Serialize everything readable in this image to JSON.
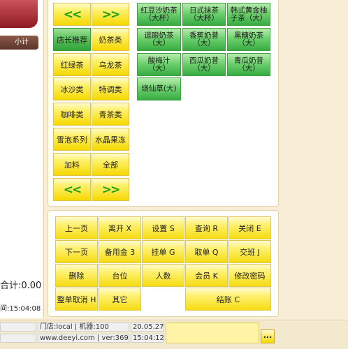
{
  "left": {
    "subtotal_label": "小计",
    "total_label": "合计:0.00",
    "time_label": "间:15:04:08"
  },
  "nav": {
    "prev": "<<",
    "next": ">>"
  },
  "categories": [
    "店长推荐",
    "奶茶类",
    "红绿茶",
    "乌龙茶",
    "冰沙类",
    "特调类",
    "咖啡类",
    "青茶类",
    "雪泡系列",
    "水晶果冻",
    "加料",
    "全部"
  ],
  "products": [
    "红豆沙奶茶（大杯）",
    "日式抹茶（大杯）",
    "韩式黄金柚子茶（大）",
    "逗眼奶茶（大）",
    "香蕉奶昔（大）",
    "黑糖奶茶（大）",
    "酸梅汁（大）",
    "西瓜奶昔（大）",
    "青瓜奶昔（大）",
    "烧仙草(大)"
  ],
  "actions": {
    "prev_page": "上一页",
    "leave": "离开 X",
    "settings": "设置 S",
    "query": "查询 R",
    "close": "关闭 E",
    "next_page": "下一页",
    "petty_cash": "备用金 3",
    "hold": "挂单 G",
    "retrieve": "取单 Q",
    "shift": "交班 J",
    "delete": "删除",
    "table": "台位",
    "people": "人数",
    "member": "会员 K",
    "change_password": "修改密码",
    "cancel_all": "整单取消 H",
    "other": "其它",
    "checkout": "结账 C"
  },
  "status": {
    "store_machine": "门店:local | 机器:100",
    "website_version": "www.deeyi.com | ver:369",
    "date": "20.05.27",
    "time": "15:04:12",
    "more": "..."
  }
}
